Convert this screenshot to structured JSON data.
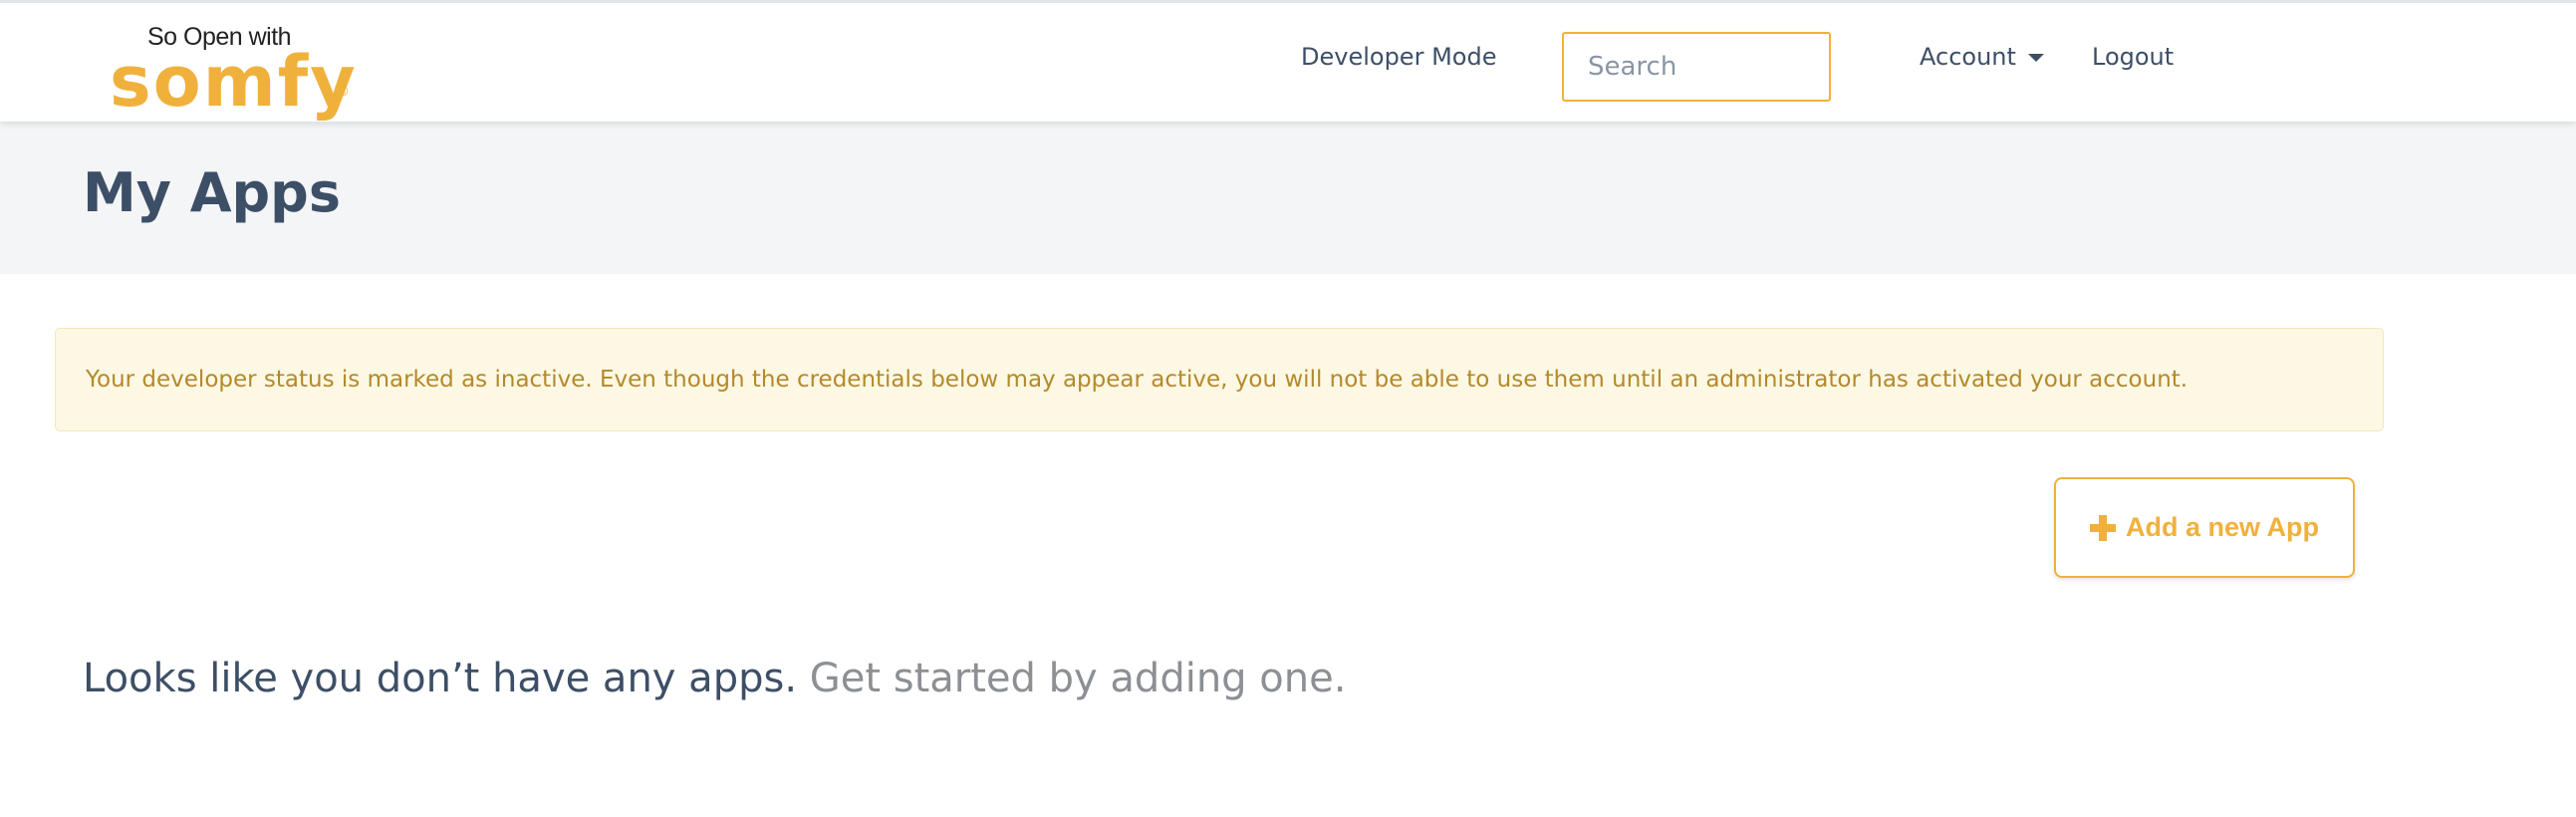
{
  "logo": {
    "tagline": "So Open with",
    "brand": "somfy",
    "registered_mark": "®",
    "color": "#f0b13c"
  },
  "nav": {
    "developer_mode": "Developer Mode",
    "search_placeholder": "Search",
    "search_value": "",
    "account": "Account",
    "logout": "Logout"
  },
  "header": {
    "title": "My Apps"
  },
  "alert": {
    "message": "Your developer status is marked as inactive. Even though the credentials below may appear active, you will not be able to use them until an administrator has activated your account."
  },
  "actions": {
    "add_app_label": "Add a new App",
    "add_app_icon": "plus-icon"
  },
  "empty_state": {
    "primary": "Looks like you don’t have any apps.",
    "secondary": "Get started by adding one."
  },
  "colors": {
    "accent": "#f0b13c",
    "text": "#3d4f66",
    "alert_background": "#fcf8e3",
    "alert_text": "#b4892b",
    "header_background": "#f4f5f7"
  }
}
